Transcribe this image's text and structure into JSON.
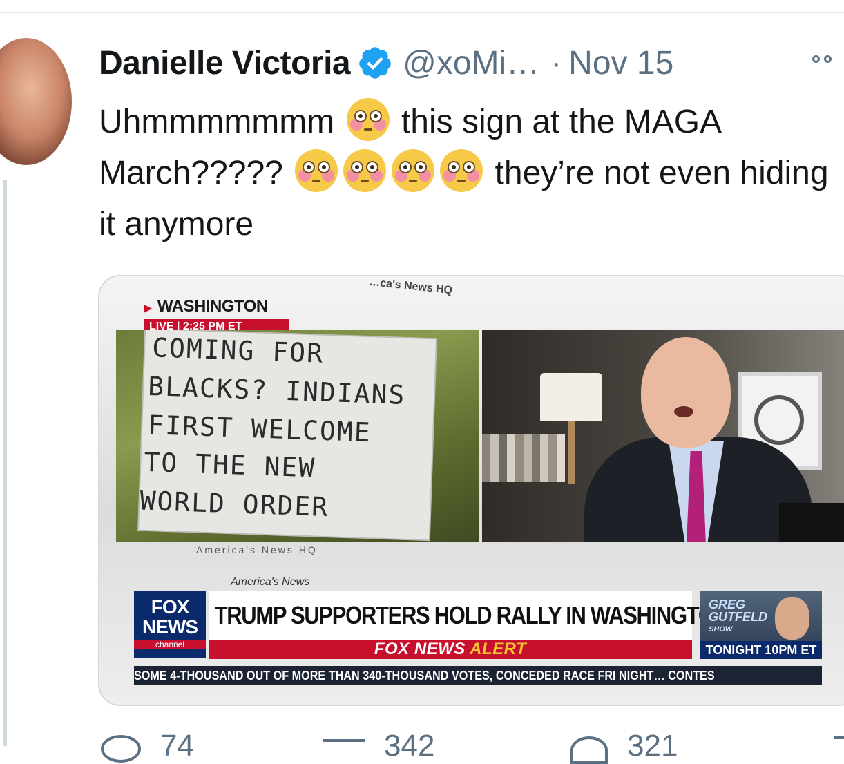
{
  "tweet": {
    "author_name": "Danielle Victoria",
    "handle": "@xoMi…",
    "separator": "·",
    "date": "Nov 15",
    "text_parts": [
      "Uhmmmmmmm",
      "this sign at the MAGA March?????",
      "they’re not even hiding it anymore"
    ]
  },
  "media": {
    "location": "WASHINGTON",
    "live": "LIVE | 2:25 PM ET",
    "studio_text_top": "…ca's News HQ",
    "studio_text_mid": "America's News HQ",
    "studio_text_low": "America's News",
    "sign_lines": [
      "COMING FOR",
      "BLACKS? INDIANS",
      "FIRST WELCOME",
      "TO THE NEW",
      "WORLD ORDER"
    ],
    "logo_line1": "FOX",
    "logo_line2": "NEWS",
    "logo_line3": "channel",
    "headline": "TRUMP SUPPORTERS HOLD RALLY IN WASHINGTON",
    "alert_part1": "FOX NEWS",
    "alert_part2": "ALERT",
    "promo_title_1": "GREG",
    "promo_title_2": "GUTFELD",
    "promo_title_3": "SHOW",
    "promo_time": "TONIGHT 10PM ET",
    "crawl": "SOME 4-THOUSAND OUT OF MORE THAN 340-THOUSAND VOTES, CONCEDED RACE FRI NIGHT…  CONTES"
  },
  "actions": {
    "reply_count": "74",
    "retweet_count": "342",
    "like_count": "321"
  },
  "colors": {
    "verified": "#1da1f2",
    "secondary_text": "#5b7083",
    "fox_red": "#c8102e",
    "fox_blue": "#0b2a6b"
  }
}
